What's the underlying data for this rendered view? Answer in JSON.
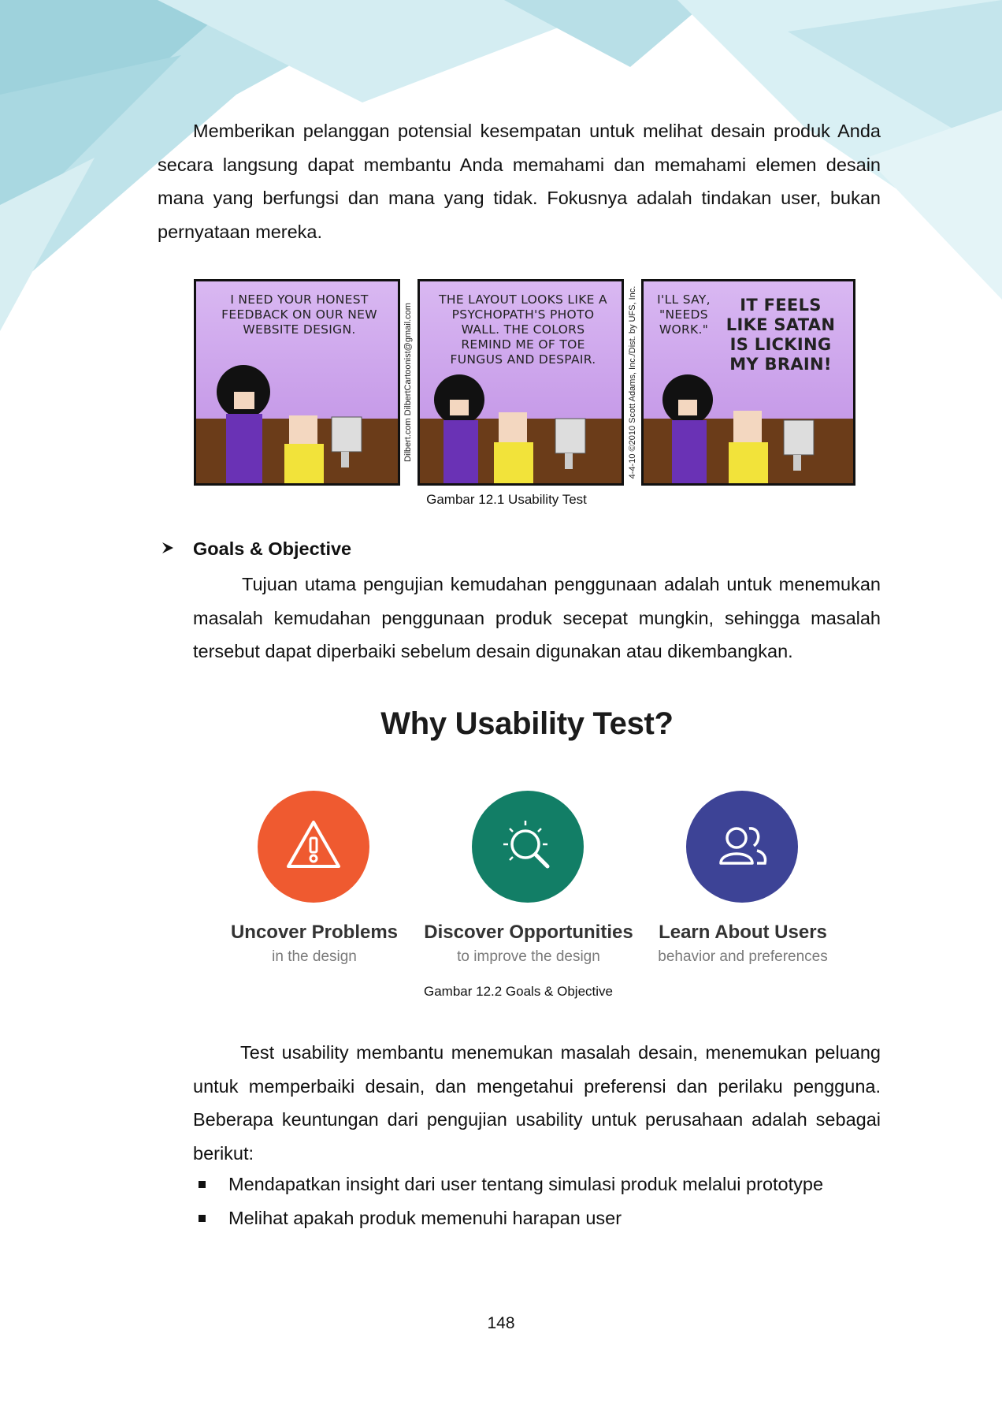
{
  "intro_lines": [
    "Memberikan pelanggan potensial kesempatan untuk melihat desain produk Anda",
    "secara langsung dapat membantu Anda memahami dan memahami elemen desain",
    "mana yang berfungsi dan mana yang tidak. Fokusnya adalah tindakan user, bukan",
    "pernyataan mereka."
  ],
  "comic": {
    "panel1_text": "I NEED YOUR HONEST FEEDBACK ON OUR NEW WEBSITE DESIGN.",
    "panel2_text": "THE LAYOUT LOOKS LIKE A PSYCHOPATH'S PHOTO WALL. THE COLORS REMIND ME OF TOE FUNGUS AND DESPAIR.",
    "panel3_small": "I'LL SAY, \"NEEDS WORK.\"",
    "panel3_big": "IT FEELS LIKE SATAN IS LICKING MY BRAIN!",
    "side1": "Dilbert.com   DilbertCartoonist@gmail.com",
    "side2": "4-4-10   ©2010 Scott Adams, Inc./Dist. by UFS, Inc."
  },
  "caption1": "Gambar 12.1 Usability Test",
  "goals_heading": "Goals & Objective",
  "goals_lines": [
    "Tujuan utama pengujian kemudahan penggunaan adalah untuk menemukan",
    "masalah kemudahan penggunaan produk secepat mungkin, sehingga masalah",
    "tersebut dapat diperbaiki sebelum desain digunakan atau dikembangkan."
  ],
  "infographic": {
    "title": "Why Usability Test?",
    "items": [
      {
        "title": "Uncover Problems",
        "subtitle": "in the design",
        "color": "#ef5a30",
        "icon": "warning-icon"
      },
      {
        "title": "Discover Opportunities",
        "subtitle": "to improve the design",
        "color": "#127e66",
        "icon": "magnifier-icon"
      },
      {
        "title": "Learn About Users",
        "subtitle": "behavior and preferences",
        "color": "#3d4396",
        "icon": "users-icon"
      }
    ]
  },
  "caption2": "Gambar 12.2 Goals & Objective",
  "benefit_lines": [
    "Test usability membantu menemukan masalah desain, menemukan peluang",
    "untuk memperbaiki desain, dan mengetahui preferensi dan perilaku pengguna.",
    "Beberapa keuntungan dari pengujian usability untuk perusahaan adalah sebagai",
    "berikut:"
  ],
  "bullets": [
    "Mendapatkan insight dari user tentang simulasi produk melalui prototype",
    "Melihat apakah produk memenuhi harapan user"
  ],
  "page_number": "148"
}
